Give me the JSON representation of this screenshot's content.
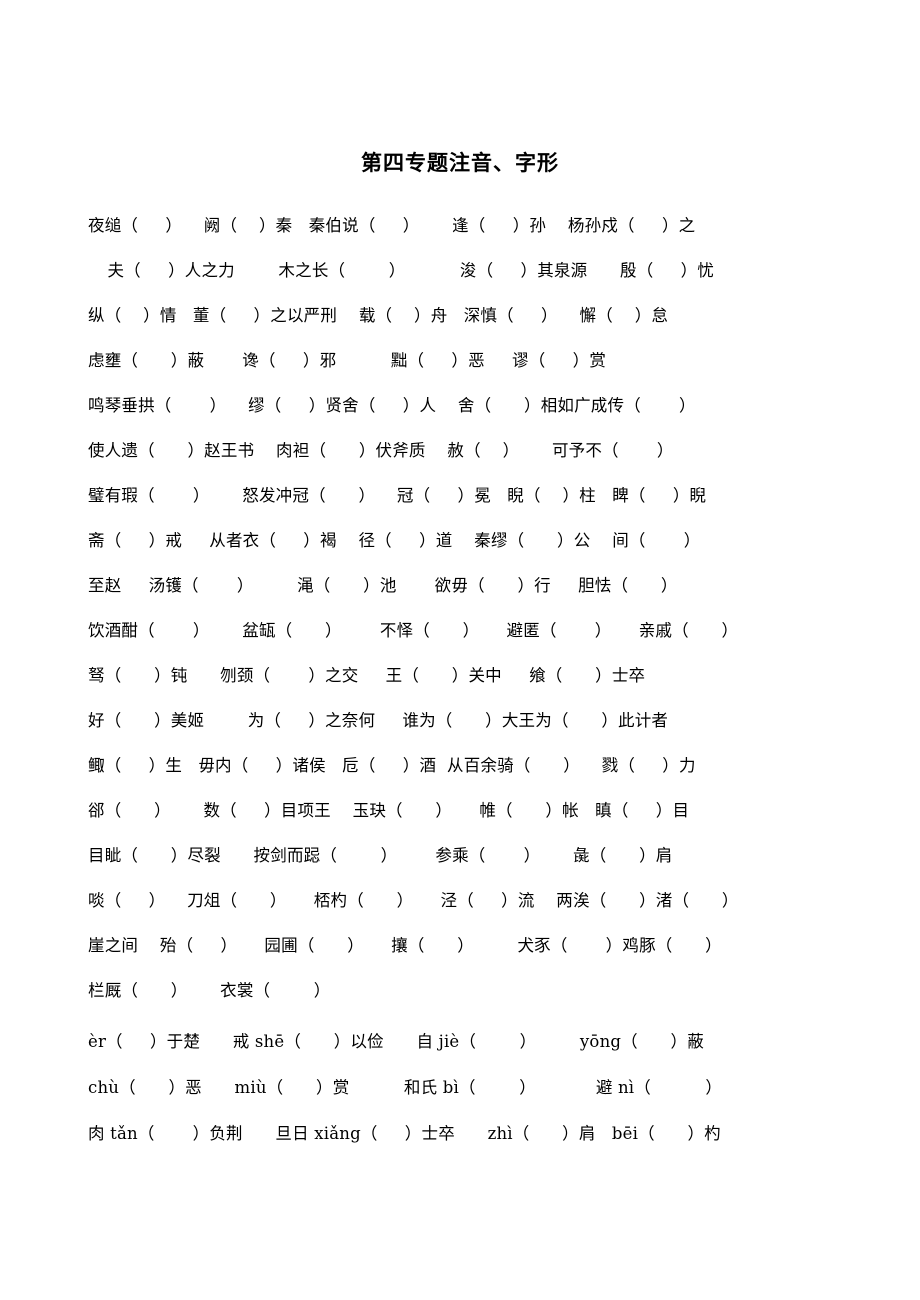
{
  "document": {
    "title": "第四专题注音、字形",
    "hanzi_lines": [
      "夜缒（     ）    阙（    ）秦   秦伯说（     ）      逢（     ）孙    杨孙戍（     ）之",
      " 夫（     ）人之力        木之长（        ）          浚（     ）其泉源      殷（     ）忧",
      "纵（    ）情   董（     ）之以严刑    载（    ）舟   深慎（     ）    懈（    ）怠",
      "虑壅（      ）蔽       谗（     ）邪          黜（     ）恶     谬（     ）赏",
      "鸣琴垂拱（       ）    缪（     ）贤舍（     ）人    舍（      ）相如广成传（       ）",
      "使人遗（      ）赵王书    肉袒（      ）伏斧质    赦（    ）      可予不（       ）",
      "璧有瑕（       ）      怒发冲冠（      ）    冠（     ）冕   睨（    ）柱   睥（     ）睨",
      "斋（     ）戒     从者衣（     ）褐    径（     ）道    秦缪（      ）公    间（       ）",
      "至赵     汤镬（       ）        渑（      ）池       欲毋（      ）行     胆怯（      ）",
      "饮酒酣（       ）      盆缻（      ）       不怿（      ）     避匿（       ）     亲戚（      ）",
      "驽（      ）钝      刎颈（       ）之交     王（      ）关中     飨（      ）士卒",
      "好（      ）美姬        为（     ）之奈何     谁为（      ）大王为（      ）此计者",
      "鲰（     ）生   毋内（     ）诸侯   卮（     ）酒  从百余骑（      ）    戮（     ）力",
      "郤（      ）      数（     ）目项王    玉玦（      ）     帷（      ）帐   瞋（     ）目",
      "目眦（      ）尽裂      按剑而跽（        ）       参乘（       ）      彘（      ）肩",
      "啖（     ）    刀俎（      ）     桮杓（      ）     泾（     ）流    两涘（      ）渚（      ）",
      "崖之间    殆（     ）     园圃（      ）     攘（      ）        犬豕（       ）鸡豚（      ）",
      "栏厩（      ）      衣裳（        ）"
    ],
    "pinyin_lines": [
      "èr（     ）于楚      戒 shē（      ）以俭      自 jiè（        ）        yōng（      ）蔽",
      "chù（      ）恶      miù（      ）赏          和氏 bì（        ）           避 nì（          ）",
      "肉 tǎn（       ）负荆      旦日 xiǎng（     ）士卒      zhì（      ）肩   bēi（      ）杓"
    ]
  }
}
